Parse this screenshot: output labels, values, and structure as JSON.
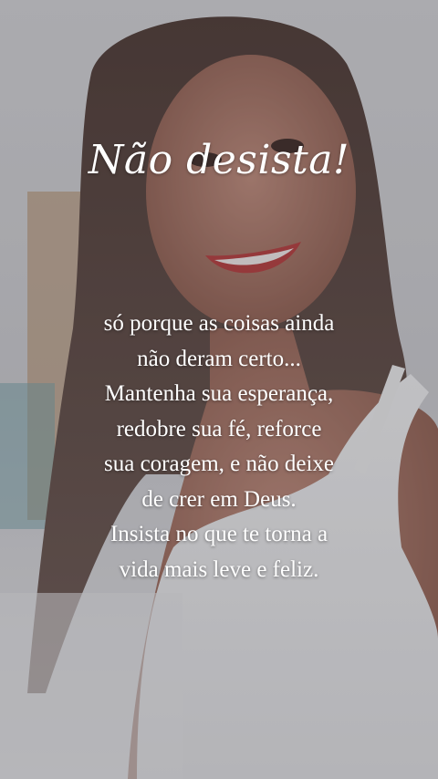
{
  "title": "Não desista!",
  "message": {
    "lines": [
      "só porque as coisas ainda",
      "não deram certo...",
      "Mantenha sua esperança,",
      "redobre sua fé, reforce",
      "sua coragem, e não deixe",
      "de crer em Deus.",
      "Insista no que te torna a",
      "vida mais leve e feliz."
    ]
  },
  "colors": {
    "text": "#ffffff",
    "overlay": "#3c3c42"
  }
}
